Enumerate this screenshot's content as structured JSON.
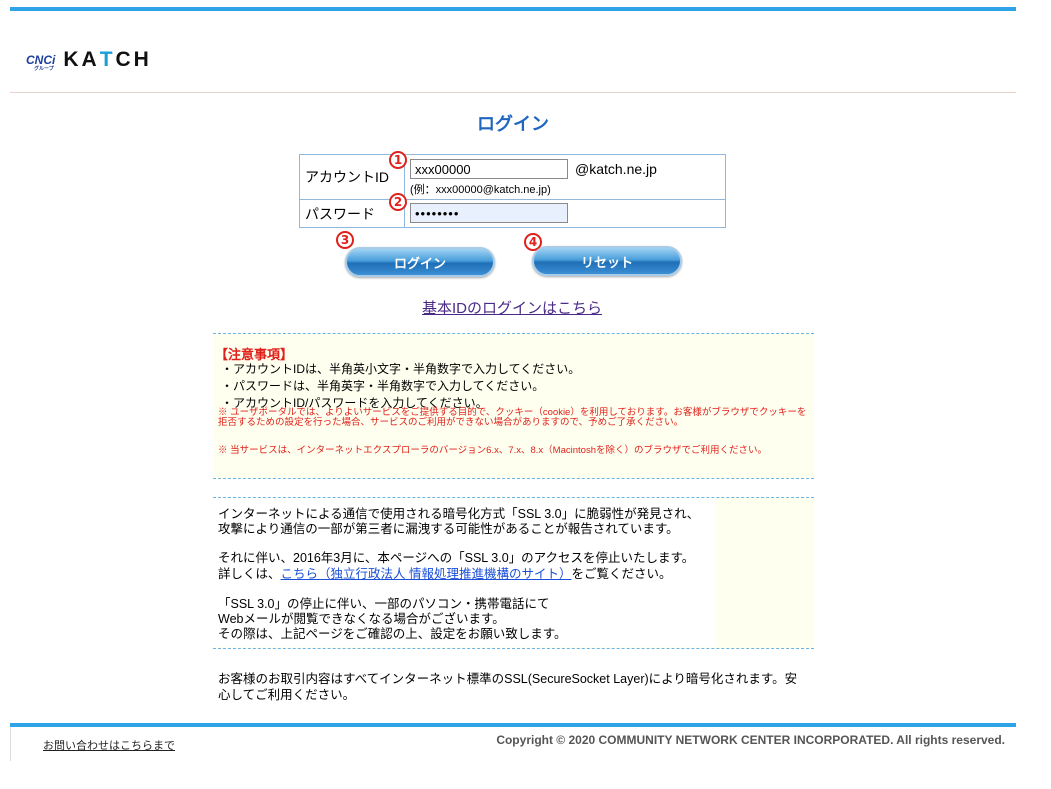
{
  "header": {
    "logo_group": "CNCi",
    "logo_group_sub": "グループ",
    "logo_brand_left": "KA",
    "logo_brand_mid": "T",
    "logo_brand_right": "CH"
  },
  "page": {
    "title": "ログイン"
  },
  "form": {
    "account_label": "アカウントID",
    "account_value": "xxx00000",
    "domain_suffix": "@katch.ne.jp",
    "account_example": "(例：xxx00000@katch.ne.jp)",
    "password_label": "パスワード",
    "password_value": "••••••••"
  },
  "markers": {
    "m1": "1",
    "m2": "2",
    "m3": "3",
    "m4": "4"
  },
  "buttons": {
    "login": "ログイン",
    "reset": "リセット"
  },
  "links": {
    "basic_login": "基本IDのログインはこちら"
  },
  "notice1": {
    "heading": "【注意事項】",
    "line1": "・アカウントIDは、半角英小文字・半角数字で入力してください。",
    "line2": "・パスワードは、半角英字・半角数字で入力してください。",
    "line3": "・アカウントID/パスワードを入力してください。",
    "warn1": "※ ユーザポータルでは、よりよいサービスをご提供する目的で、クッキー（cookie）を利用しております。お客様がブラウザでクッキーを拒否するための設定を行った場合、サービスのご利用ができない場合がありますので、予めご了承ください。",
    "warn2": "※ 当サービスは、インターネットエクスプローラのバージョン6.x、7.x、8.x（Macintoshを除く）のブラウザでご利用ください。"
  },
  "notice2": {
    "p1a": "インターネットによる通信で使用される暗号化方式「SSL 3.0」に脆弱性が発見され、",
    "p1b": "攻撃により通信の一部が第三者に漏洩する可能性があることが報告されています。",
    "p2a": "それに伴い、2016年3月に、本ページへの「SSL 3.0」のアクセスを停止いたします。",
    "p2b_pre": "詳しくは、",
    "p2b_link": "こちら（独立行政法人 情報処理推進機構のサイト）",
    "p2b_post": "をご覧ください。",
    "p3a": "「SSL 3.0」の停止に伴い、一部のパソコン・携帯電話にて",
    "p3b": "Webメールが閲覧できなくなる場合がございます。",
    "p3c": "その際は、上記ページをご確認の上、設定をお願い致します。"
  },
  "ssl_notice": "お客様のお取引内容はすべてインターネット標準のSSL(SecureSocket Layer)により暗号化されます。安心してご利用ください。",
  "footer": {
    "contact_link": "お問い合わせはこちらまで",
    "copyright": "Copyright © 2020 COMMUNITY NETWORK CENTER INCORPORATED. All rights reserved."
  },
  "colors": {
    "accent": "#2fa3e8",
    "title": "#1f66c1",
    "marker": "#e0201a",
    "notice_bg": "#fffff0"
  }
}
